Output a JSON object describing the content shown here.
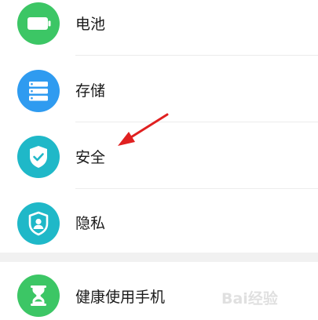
{
  "settings": {
    "items": [
      {
        "label": "电池",
        "icon": "battery-icon",
        "color": "#3cc665"
      },
      {
        "label": "存储",
        "icon": "storage-icon",
        "color": "#2f9bf0"
      },
      {
        "label": "安全",
        "icon": "shield-check-icon",
        "color": "#1fb8c8"
      },
      {
        "label": "隐私",
        "icon": "privacy-shield-icon",
        "color": "#1fb8c8"
      },
      {
        "label": "健康使用手机",
        "icon": "hourglass-icon",
        "color": "#3cc665"
      }
    ]
  },
  "annotation": {
    "color": "#e02020"
  },
  "watermark": {
    "text": "Bai经验",
    "source": "jingyan.baidu.com"
  }
}
